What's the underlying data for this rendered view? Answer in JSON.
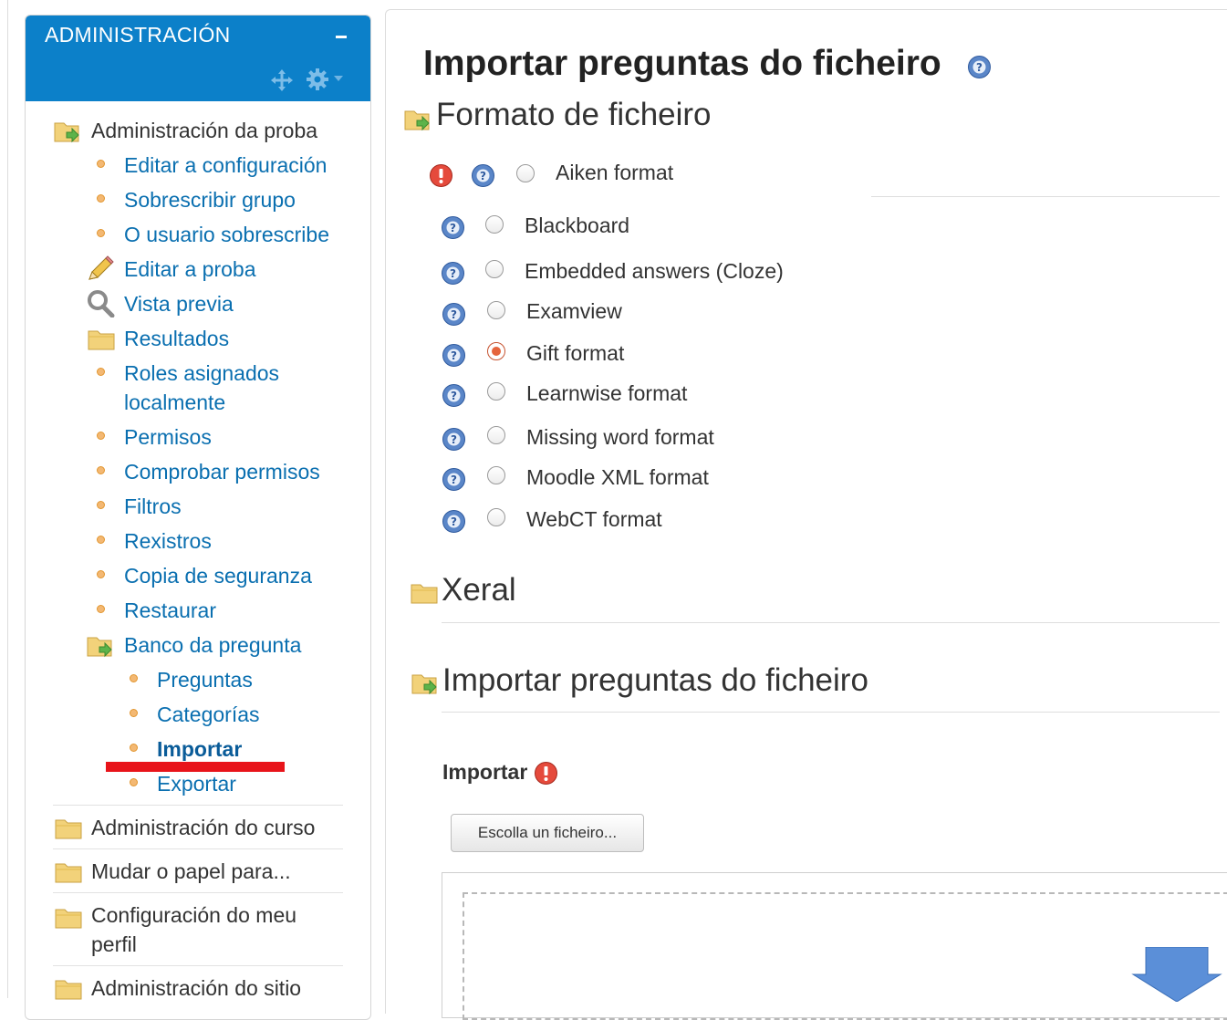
{
  "sidebar": {
    "title": "ADMINISTRACIÓN",
    "items": [
      {
        "label": "Administración da proba",
        "icon": "folder-open-icon",
        "type": "plain"
      },
      {
        "label": "Editar a configuración",
        "icon": "bullet",
        "type": "link"
      },
      {
        "label": "Sobrescribir grupo",
        "icon": "bullet",
        "type": "link"
      },
      {
        "label": "O usuario sobrescribe",
        "icon": "bullet",
        "type": "link"
      },
      {
        "label": "Editar a proba",
        "icon": "pencil-icon",
        "type": "link"
      },
      {
        "label": "Vista previa",
        "icon": "magnifier-icon",
        "type": "link"
      },
      {
        "label": "Resultados",
        "icon": "folder-icon",
        "type": "link"
      },
      {
        "label": "Roles asignados",
        "label2": "localmente",
        "icon": "bullet",
        "type": "link"
      },
      {
        "label": "Permisos",
        "icon": "bullet",
        "type": "link"
      },
      {
        "label": "Comprobar permisos",
        "icon": "bullet",
        "type": "link"
      },
      {
        "label": "Filtros",
        "icon": "bullet",
        "type": "link"
      },
      {
        "label": "Rexistros",
        "icon": "bullet",
        "type": "link"
      },
      {
        "label": "Copia de seguranza",
        "icon": "bullet",
        "type": "link"
      },
      {
        "label": "Restaurar",
        "icon": "bullet",
        "type": "link"
      },
      {
        "label": "Banco da pregunta",
        "icon": "folder-open-icon",
        "type": "link"
      },
      {
        "label": "Preguntas",
        "icon": "bullet",
        "type": "link"
      },
      {
        "label": "Categorías",
        "icon": "bullet",
        "type": "link"
      },
      {
        "label": "Importar",
        "icon": "bullet",
        "type": "active"
      },
      {
        "label": "Exportar",
        "icon": "bullet",
        "type": "link"
      },
      {
        "label": "Administración do curso",
        "icon": "folder-icon",
        "type": "plain"
      },
      {
        "label": "Mudar o papel para...",
        "icon": "folder-icon",
        "type": "plain"
      },
      {
        "label": "Configuración do meu",
        "label2": "perfil",
        "icon": "folder-icon",
        "type": "plain"
      },
      {
        "label": "Administración do sitio",
        "icon": "folder-icon",
        "type": "plain"
      }
    ]
  },
  "main": {
    "title": "Importar preguntas do ficheiro",
    "format_section": {
      "legend": "Formato de ficheiro",
      "options": [
        {
          "label": "Aiken format",
          "checked": false
        },
        {
          "label": "Blackboard",
          "checked": false
        },
        {
          "label": "Embedded answers (Cloze)",
          "checked": false
        },
        {
          "label": "Examview",
          "checked": false
        },
        {
          "label": "Gift format",
          "checked": true
        },
        {
          "label": "Learnwise format",
          "checked": false
        },
        {
          "label": "Missing word format",
          "checked": false
        },
        {
          "label": "Moodle XML format",
          "checked": false
        },
        {
          "label": "WebCT format",
          "checked": false
        }
      ]
    },
    "general_section": {
      "legend": "Xeral"
    },
    "import_section": {
      "legend": "Importar preguntas do ficheiro",
      "field_label": "Importar",
      "choose_button": "Escolla un ficheiro..."
    }
  },
  "colors": {
    "header_blue": "#0c80c9",
    "link_blue": "#0a6fb0",
    "annotation_red": "#e8141a",
    "radio_checked": "#e5643c"
  }
}
